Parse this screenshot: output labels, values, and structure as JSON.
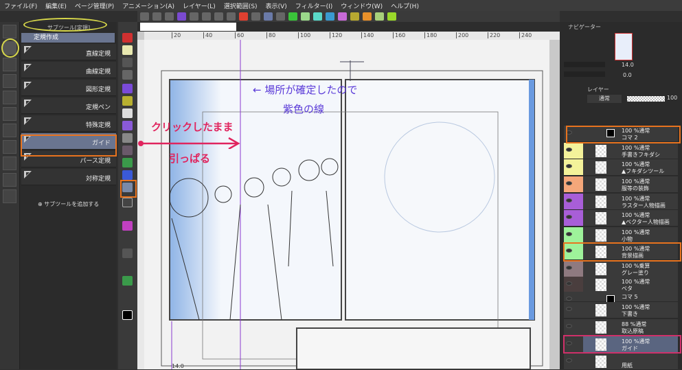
{
  "menu": [
    "ファイル(F)",
    "編集(E)",
    "ページ管理(P)",
    "アニメーション(A)",
    "レイヤー(L)",
    "選択範囲(S)",
    "表示(V)",
    "フィルター(I)",
    "ウィンドウ(W)",
    "ヘルプ(H)"
  ],
  "subtool": {
    "tab": "サブツール[定規]",
    "group": "定規作成",
    "items": [
      "直線定規",
      "曲線定規",
      "図形定規",
      "定規ペン",
      "特殊定規",
      "ガイド",
      "パース定規",
      "対称定規"
    ],
    "selected": "ガイド",
    "add": "サブツールを追加する"
  },
  "ruler": {
    "ticks": [
      "20",
      "40",
      "60",
      "80",
      "100",
      "120",
      "140",
      "160",
      "180",
      "200",
      "220",
      "240"
    ]
  },
  "annotations": {
    "arrow_note_1": "← 場所が確定したので",
    "arrow_note_2": "紫色の線",
    "drag_note_1": "クリックしたまま",
    "drag_note_2": "引っぱる"
  },
  "navigator": {
    "tab": "ナビゲーター",
    "zoom": "14.0",
    "rotate": "0.0"
  },
  "layers": {
    "tab": "レイヤー",
    "blend": "通常",
    "opacity": "100",
    "items": [
      {
        "mode": "100 %通常",
        "name": "コマ 2",
        "color": "#3a3a3a",
        "folder": true
      },
      {
        "mode": "100 %通常",
        "name": "手書きフキダシ",
        "color": "#f4f29a"
      },
      {
        "mode": "100 %通常",
        "name": "▲フキダシツール",
        "color": "#f4f29a"
      },
      {
        "mode": "100 %通常",
        "name": "服等の装飾",
        "color": "#f5a77a"
      },
      {
        "mode": "100 %通常",
        "name": "ラスター人物描画",
        "color": "#a85ed8"
      },
      {
        "mode": "100 %通常",
        "name": "▲ベクター人物描画",
        "color": "#a85ed8"
      },
      {
        "mode": "100 %通常",
        "name": "小物",
        "color": "#9ef29a"
      },
      {
        "mode": "100 %通常",
        "name": "背景描画",
        "color": "#9ef29a"
      },
      {
        "mode": "100 %乗算",
        "name": "グレー塗り",
        "color": "#8f7a80"
      },
      {
        "mode": "100 %通常",
        "name": "ベタ",
        "color": "#4a3e3e"
      },
      {
        "mode": "",
        "name": "コマ 5",
        "color": "#3a3a3a",
        "folder": true
      },
      {
        "mode": "100 %通常",
        "name": "下書き",
        "color": "#3a3a3a"
      },
      {
        "mode": "88 %通常",
        "name": "取込原稿",
        "color": "#3a3a3a"
      },
      {
        "mode": "100 %通常",
        "name": "ガイド",
        "color": "#3a3a3a"
      },
      {
        "mode": "",
        "name": "用紙",
        "color": "#3a3a3a"
      }
    ]
  },
  "status": {
    "zoom": "14.0"
  },
  "colors": {
    "highlight": "#e8731e",
    "selected_border": "#d0306a",
    "note_purple": "#5a3ad8",
    "note_pink": "#e0245e",
    "guide_line": "#8a3ad0"
  }
}
